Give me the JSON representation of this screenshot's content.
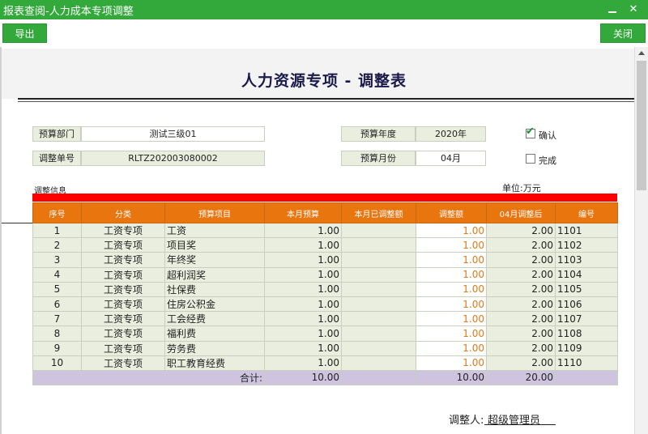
{
  "window": {
    "title": "报表查阅-人力成本专项调整",
    "minimize_label": "",
    "close_label": "✕"
  },
  "toolbar": {
    "export_label": "导出",
    "close_label": "关闭"
  },
  "report": {
    "title": "人力资源专项 - 调整表"
  },
  "form": {
    "dept_label": "预算部门",
    "dept_value": "测试三级01",
    "year_label": "预算年度",
    "year_value": "2020年",
    "doc_label": "调整单号",
    "doc_value": "RLTZ202003080002",
    "month_label": "预算月份",
    "month_value": "04月",
    "confirm_label": "确认",
    "confirm_checked": true,
    "done_label": "完成",
    "done_checked": false
  },
  "section": {
    "title": "调整信息",
    "unit": "单位:万元"
  },
  "table": {
    "headers": [
      "序号",
      "分类",
      "预算项目",
      "本月预算",
      "本月已调整额",
      "调整额",
      "04月调整后",
      "编号"
    ],
    "rows": [
      [
        "1",
        "工资专项",
        "工资",
        "1.00",
        "",
        "1.00",
        "2.00",
        "1101"
      ],
      [
        "2",
        "工资专项",
        "项目奖",
        "1.00",
        "",
        "1.00",
        "2.00",
        "1102"
      ],
      [
        "3",
        "工资专项",
        "年终奖",
        "1.00",
        "",
        "1.00",
        "2.00",
        "1103"
      ],
      [
        "4",
        "工资专项",
        "超利润奖",
        "1.00",
        "",
        "1.00",
        "2.00",
        "1104"
      ],
      [
        "5",
        "工资专项",
        "社保费",
        "1.00",
        "",
        "1.00",
        "2.00",
        "1105"
      ],
      [
        "6",
        "工资专项",
        "住房公积金",
        "1.00",
        "",
        "1.00",
        "2.00",
        "1106"
      ],
      [
        "7",
        "工资专项",
        "工会经费",
        "1.00",
        "",
        "1.00",
        "2.00",
        "1107"
      ],
      [
        "8",
        "工资专项",
        "福利费",
        "1.00",
        "",
        "1.00",
        "2.00",
        "1108"
      ],
      [
        "9",
        "工资专项",
        "劳务费",
        "1.00",
        "",
        "1.00",
        "2.00",
        "1109"
      ],
      [
        "10",
        "工资专项",
        "职工教育经费",
        "1.00",
        "",
        "1.00",
        "2.00",
        "1110"
      ]
    ],
    "total": {
      "label": "合计:",
      "budget": "10.00",
      "adjusted_already": "",
      "adjust": "10.00",
      "after": "20.00",
      "code": ""
    }
  },
  "signer": {
    "label": "调整人:",
    "value": "超级管理员"
  },
  "colors": {
    "titlebar": "#33a93b",
    "header_orange": "#e9750f",
    "alert_red": "#ff0000",
    "cell_green": "#e9eede",
    "total_purple": "#cec4e0",
    "adjust_text": "#e07a1a"
  }
}
